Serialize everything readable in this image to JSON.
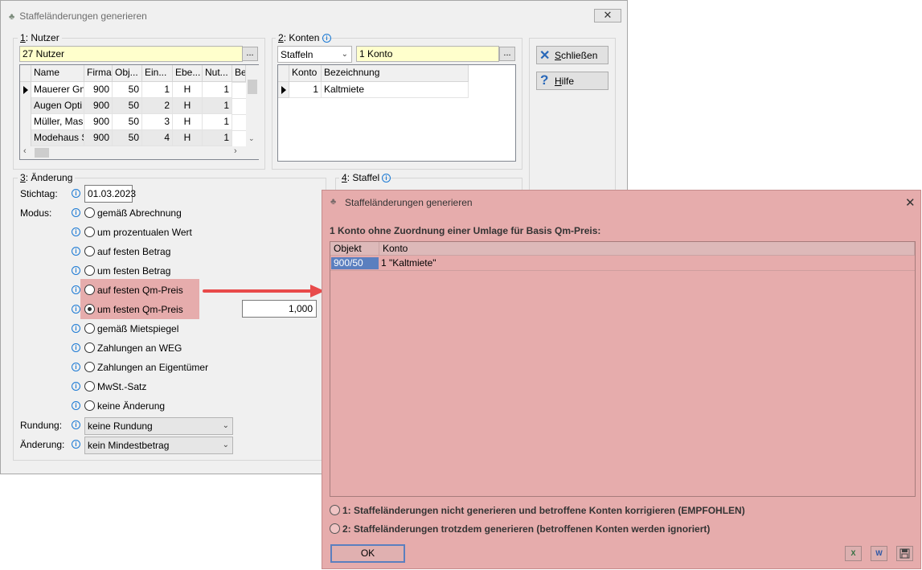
{
  "main": {
    "title": "Staffeländerungen generieren",
    "close_label": "✕",
    "nutzer": {
      "label_key": "1",
      "label_rest": ": Nutzer",
      "value": "27 Nutzer",
      "dots": "...",
      "columns": [
        "Name",
        "Firma",
        "Obj...",
        "Ein...",
        "Ebe...",
        "Nut...",
        "Be"
      ],
      "rows": [
        [
          "Mauerer Gn",
          "900",
          "50",
          "1",
          "H",
          "1"
        ],
        [
          "Augen Opti",
          "900",
          "50",
          "2",
          "H",
          "1"
        ],
        [
          "Müller, Mas",
          "900",
          "50",
          "3",
          "H",
          "1"
        ],
        [
          "Modehaus S",
          "900",
          "50",
          "4",
          "H",
          "1"
        ]
      ]
    },
    "konten": {
      "label_key": "2",
      "label_rest": ": Konten",
      "mode": "Staffeln",
      "value": "1 Konto",
      "dots": "...",
      "columns": [
        "Konto",
        "Bezeichnung"
      ],
      "rows": [
        [
          "1",
          "Kaltmiete"
        ]
      ]
    },
    "buttons": {
      "close_key": "S",
      "close_rest": "chließen",
      "help_key": "H",
      "help_rest": "ilfe"
    },
    "aenderung": {
      "label_key": "3",
      "label_rest": ": Änderung",
      "stichtag_label": "Stichtag:",
      "stichtag_value": "01.03.2023",
      "modus_label": "Modus:",
      "modes": [
        "gemäß Abrechnung",
        "um prozentualen Wert",
        "auf festen Betrag",
        "um festen Betrag",
        "auf festen Qm-Preis",
        "um festen Qm-Preis",
        "gemäß Mietspiegel",
        "Zahlungen an WEG",
        "Zahlungen an Eigentümer",
        "MwSt.-Satz",
        "keine Änderung"
      ],
      "selected_mode": "um festen Qm-Preis",
      "amount": "1,000",
      "rundung_label": "Rundung:",
      "rundung_value": "keine Rundung",
      "aenderung_label": "Änderung:",
      "aenderung_value": "kein Mindestbetrag"
    },
    "staffel": {
      "label_key": "4",
      "label_rest": ": Staffel"
    }
  },
  "dialog": {
    "title": "Staffeländerungen generieren",
    "close_label": "✕",
    "message": "1 Konto ohne Zuordnung einer Umlage für Basis Qm-Preis:",
    "columns": [
      "Objekt",
      "Konto"
    ],
    "rows": [
      [
        "900/50",
        "1 \"Kaltmiete\""
      ]
    ],
    "option1": "1: Staffeländerungen nicht generieren und betroffene Konten korrigieren (EMPFOHLEN)",
    "option2": "2: Staffeländerungen trotzdem generieren (betroffenen Konten werden ignoriert)",
    "ok_label": "OK",
    "export_excel": "X",
    "export_word": "W"
  },
  "colors": {
    "highlight": "#e6acac",
    "arrow": "#e84a4a",
    "selection": "#5b7fbf"
  },
  "icons": [
    "app-icon",
    "close-icon",
    "info-icon",
    "row-pointer-icon",
    "scroll-up-icon",
    "scroll-down-icon",
    "scroll-left-icon",
    "scroll-right-icon",
    "close-x-icon",
    "help-icon",
    "chevron-down-icon",
    "arrow-icon",
    "excel-export-icon",
    "word-export-icon",
    "save-icon"
  ]
}
